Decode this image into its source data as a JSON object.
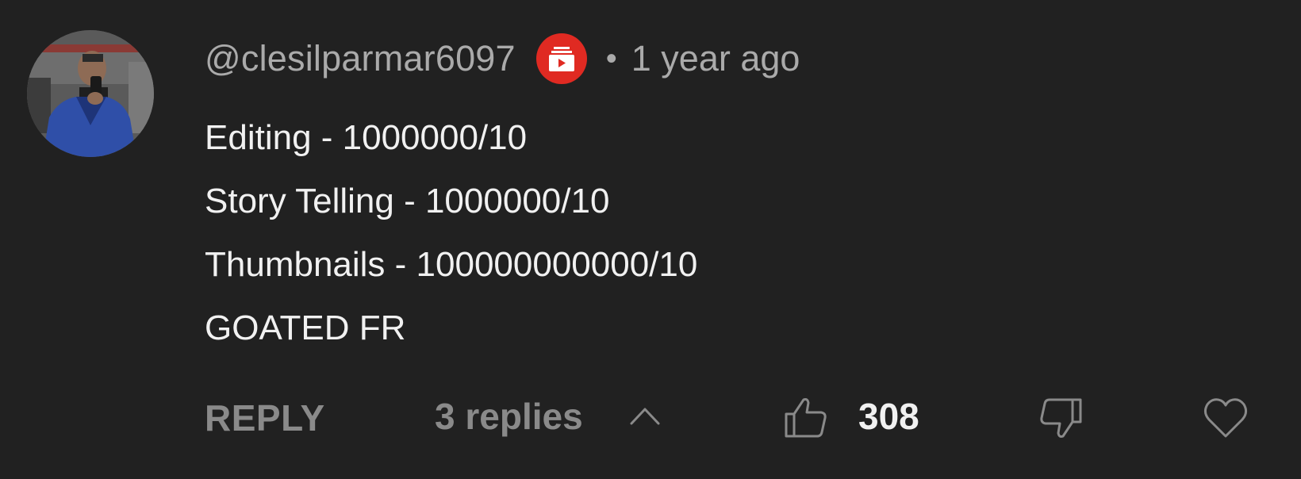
{
  "comment": {
    "author": "@clesilparmar6097",
    "badge_icon": "membership-badge-icon",
    "badge_color": "#e02a22",
    "separator": "•",
    "timestamp": "1 year ago",
    "lines": [
      "Editing - 1000000/10",
      "Story Telling - 1000000/10",
      "Thumbnails - 100000000000/10",
      "GOATED FR"
    ]
  },
  "actions": {
    "reply_label": "REPLY",
    "replies_label": "3 replies",
    "replies_toggle_icon": "chevron-up-icon",
    "like_icon": "thumbs-up-icon",
    "like_count": "308",
    "dislike_icon": "thumbs-down-icon",
    "heart_icon": "heart-icon"
  }
}
